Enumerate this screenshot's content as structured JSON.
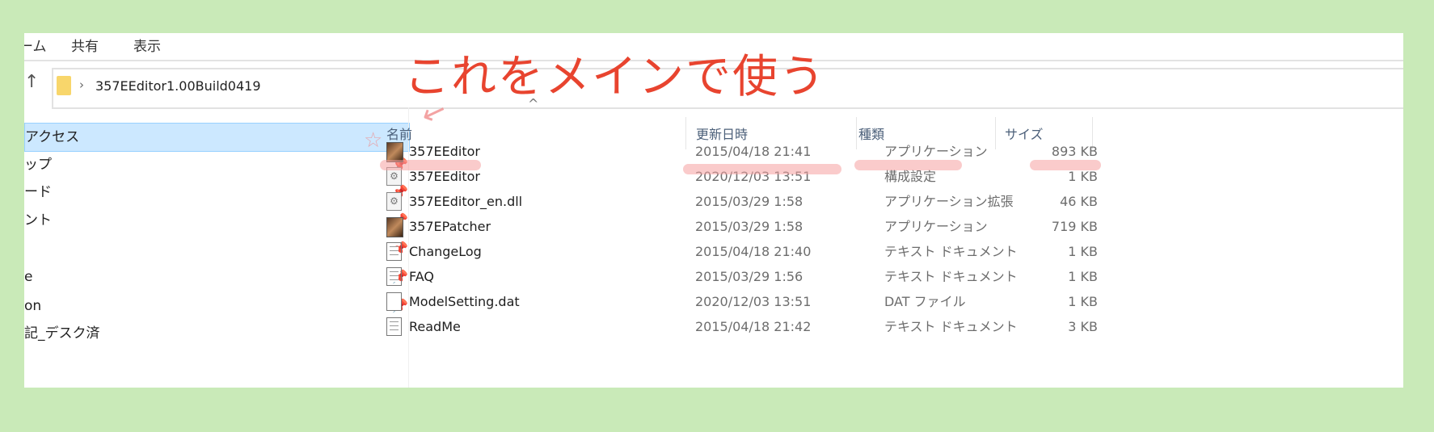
{
  "ribbon": {
    "tabs": [
      "ーム",
      "共有",
      "表示"
    ]
  },
  "address": {
    "path": "357EEditor1.00Build0419",
    "separator": "›"
  },
  "sidebar": {
    "items": [
      {
        "label": "アクセス",
        "pinned": false,
        "selected": true
      },
      {
        "label": "ップ",
        "pinned": true
      },
      {
        "label": "ード",
        "pinned": true
      },
      {
        "label": "ント",
        "pinned": true
      },
      {
        "label": "",
        "pinned": true
      },
      {
        "label": "e",
        "pinned": true
      },
      {
        "label": "on",
        "pinned": true
      },
      {
        "label": "記_デスク済",
        "pinned": false
      }
    ]
  },
  "columns": {
    "name": "名前",
    "date": "更新日時",
    "type": "種類",
    "size": "サイズ",
    "sort_indicator": "^"
  },
  "files": [
    {
      "name": "357EEditor",
      "date": "2015/04/18 21:41",
      "type": "アプリケーション",
      "size": "893 KB",
      "icon": "app-icon"
    },
    {
      "name": "357EEditor",
      "date": "2020/12/03 13:51",
      "type": "構成設定",
      "size": "1 KB",
      "icon": "config-icon"
    },
    {
      "name": "357EEditor_en.dll",
      "date": "2015/03/29 1:58",
      "type": "アプリケーション拡張",
      "size": "46 KB",
      "icon": "dll-icon"
    },
    {
      "name": "357EPatcher",
      "date": "2015/03/29 1:58",
      "type": "アプリケーション",
      "size": "719 KB",
      "icon": "app-icon"
    },
    {
      "name": "ChangeLog",
      "date": "2015/04/18 21:40",
      "type": "テキスト ドキュメント",
      "size": "1 KB",
      "icon": "text-doc-icon"
    },
    {
      "name": "FAQ",
      "date": "2015/03/29 1:56",
      "type": "テキスト ドキュメント",
      "size": "1 KB",
      "icon": "text-doc-icon"
    },
    {
      "name": "ModelSetting.dat",
      "date": "2020/12/03 13:51",
      "type": "DAT ファイル",
      "size": "1 KB",
      "icon": "blank-file-icon"
    },
    {
      "name": "ReadMe",
      "date": "2015/04/18 21:42",
      "type": "テキスト ドキュメント",
      "size": "3 KB",
      "icon": "text-doc-icon"
    }
  ],
  "annotation": {
    "text": "これをメインで使う",
    "color": "#e8442f"
  },
  "colors": {
    "background": "#c9eab8",
    "selection": "#cce8ff",
    "highlight": "#f5a0a0"
  }
}
